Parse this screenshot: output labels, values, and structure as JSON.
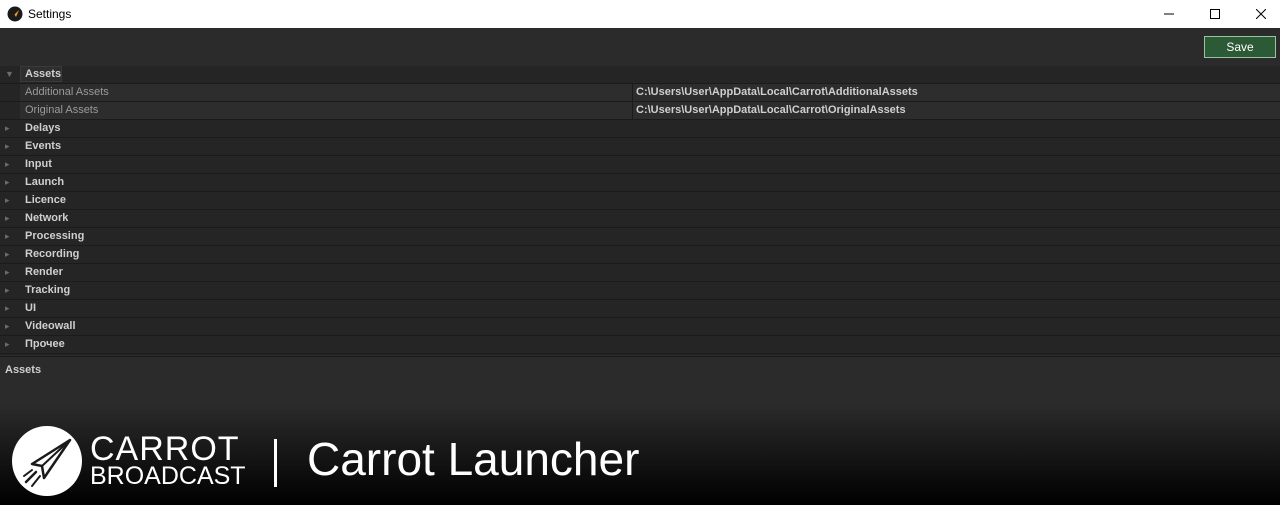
{
  "window": {
    "title": "Settings",
    "minimize_icon": "minimize-icon",
    "maximize_icon": "maximize-icon",
    "close_icon": "close-icon"
  },
  "toolbar": {
    "save_label": "Save"
  },
  "tree": {
    "groups": [
      {
        "label": "Assets",
        "expanded": true,
        "properties": [
          {
            "name": "Additional Assets",
            "value": "C:\\Users\\User\\AppData\\Local\\Carrot\\AdditionalAssets"
          },
          {
            "name": "Original Assets",
            "value": "C:\\Users\\User\\AppData\\Local\\Carrot\\OriginalAssets"
          }
        ]
      },
      {
        "label": "Delays",
        "expanded": false
      },
      {
        "label": "Events",
        "expanded": false
      },
      {
        "label": "Input",
        "expanded": false
      },
      {
        "label": "Launch",
        "expanded": false
      },
      {
        "label": "Licence",
        "expanded": false
      },
      {
        "label": "Network",
        "expanded": false
      },
      {
        "label": "Processing",
        "expanded": false
      },
      {
        "label": "Recording",
        "expanded": false
      },
      {
        "label": "Render",
        "expanded": false
      },
      {
        "label": "Tracking",
        "expanded": false
      },
      {
        "label": "UI",
        "expanded": false
      },
      {
        "label": "Videowall",
        "expanded": false
      },
      {
        "label": "Прочее",
        "expanded": false
      }
    ]
  },
  "description": {
    "title": "Assets"
  },
  "banner": {
    "brand_line1": "CARROT",
    "brand_line2": "BROADCAST",
    "product": "Carrot Launcher",
    "logo_icon": "paper-plane-icon"
  },
  "colors": {
    "save_button": "#2d5a36",
    "background": "#2b2b2b",
    "tree_background": "#252525"
  }
}
